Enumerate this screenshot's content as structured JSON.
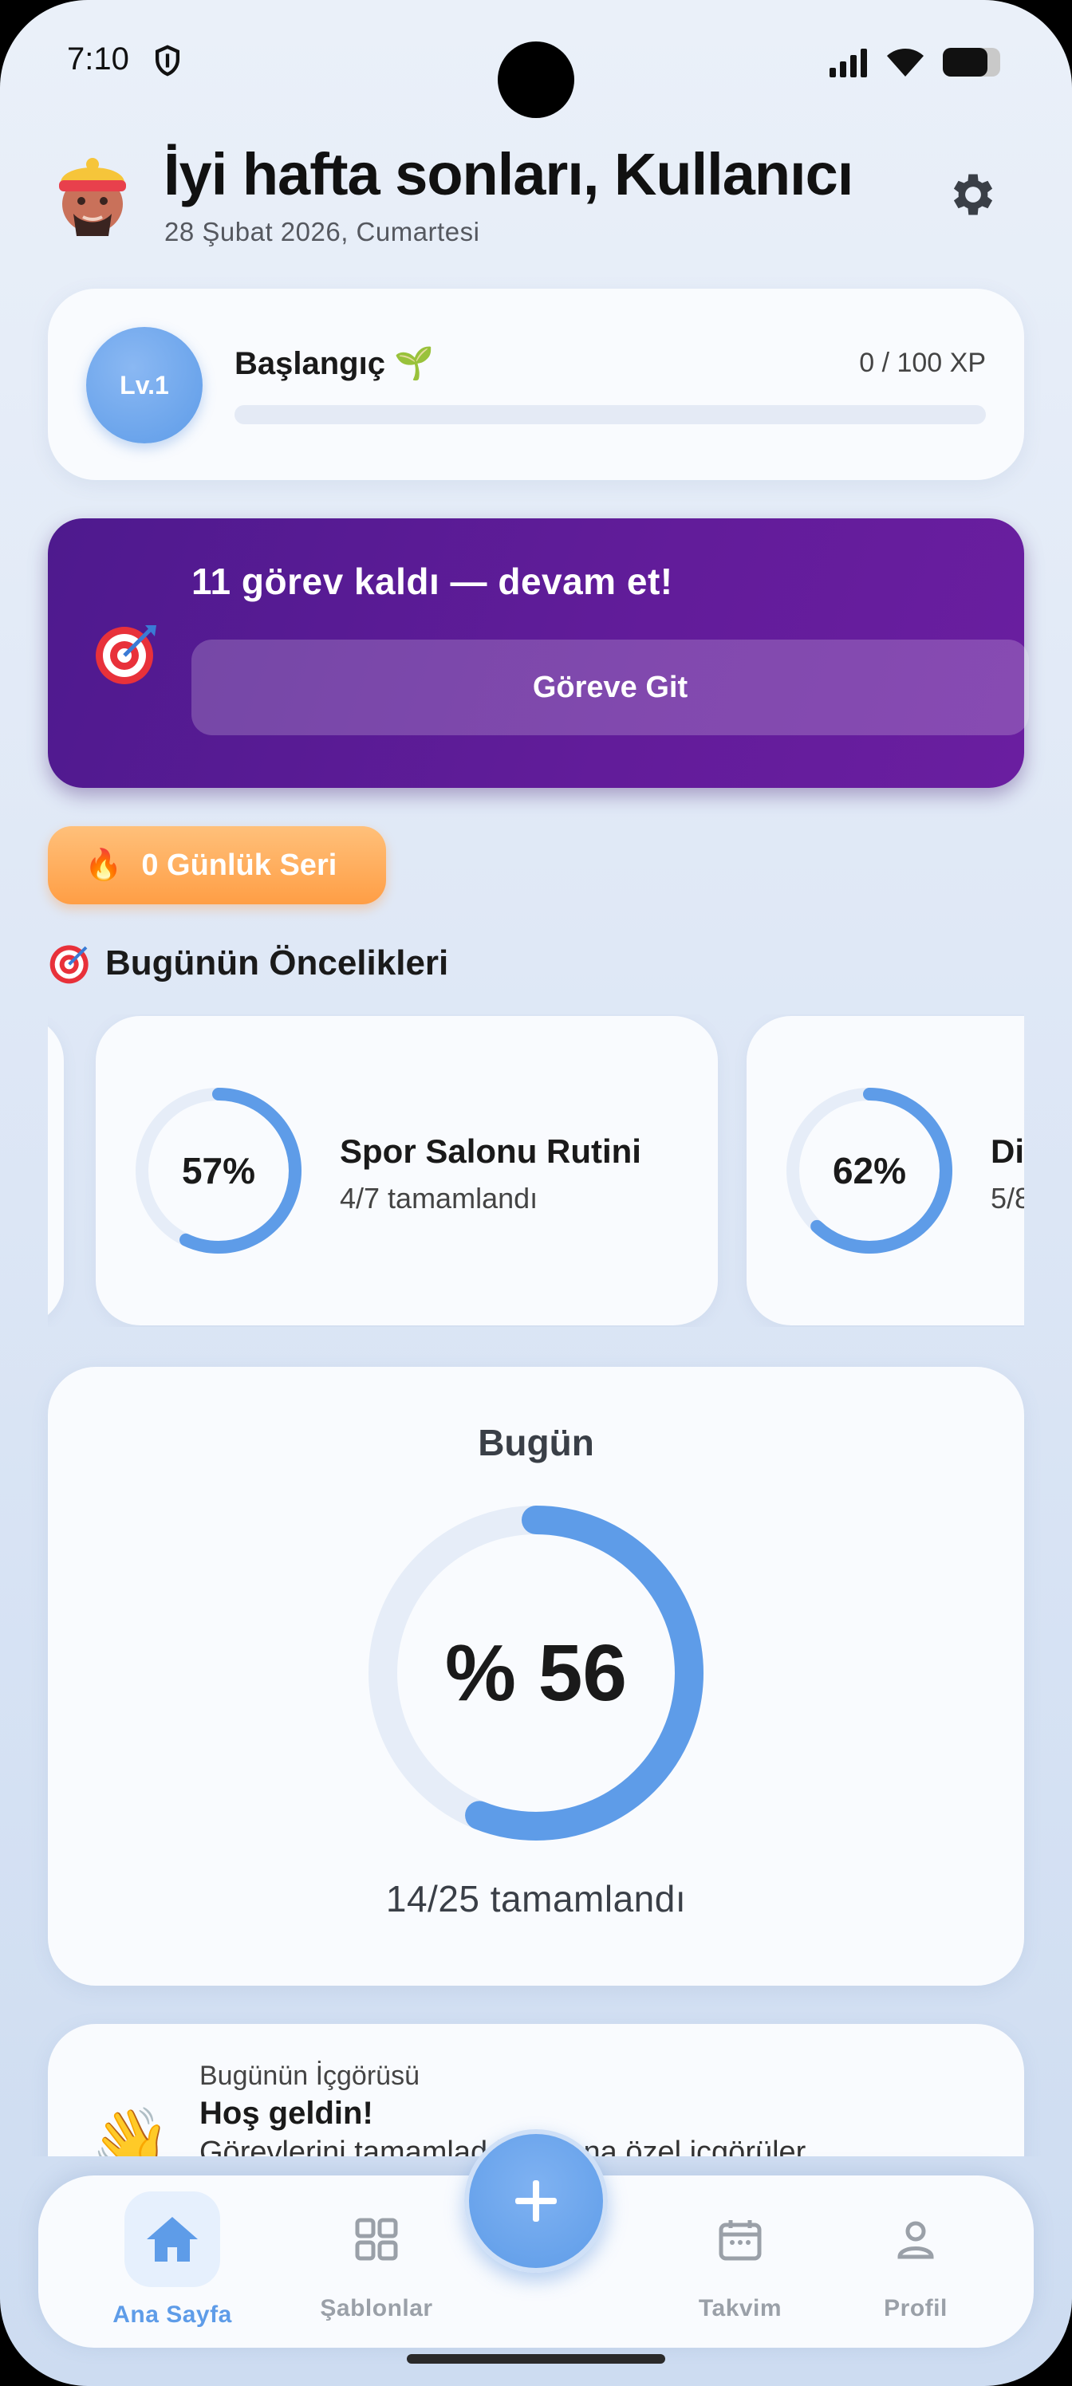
{
  "status_bar": {
    "time": "7:10"
  },
  "header": {
    "greeting": "İyi hafta sonları, Kullanıcı",
    "date": "28 Şubat 2026, Cumartesi"
  },
  "level": {
    "badge": "Lv.1",
    "title": "Başlangıç 🌱",
    "xp": "0 / 100 XP",
    "progress": 0
  },
  "task_banner": {
    "title": "11 görev kaldı — devam et!",
    "button": "Göreve Git"
  },
  "streak": {
    "label": "0 Günlük Seri"
  },
  "priorities": {
    "title": "Bugünün Öncelikleri",
    "items": [
      {
        "percent": "57%",
        "value": 0.57,
        "name": "Spor Salonu Rutini",
        "sub": "4/7 tamamlandı"
      },
      {
        "percent": "62%",
        "value": 0.62,
        "name": "Di",
        "sub": "5/8"
      }
    ]
  },
  "today": {
    "title": "Bugün",
    "percent": "% 56",
    "value": 0.56,
    "sub": "14/25 tamamlandı"
  },
  "insight": {
    "label": "Bugünün İçgörüsü",
    "title": "Hoş geldin!",
    "text": "Görevlerini tamamladıkça sana özel içgörüler",
    "emoji": "👋"
  },
  "nav": {
    "items": [
      {
        "label": "Ana Sayfa",
        "icon": "home-icon"
      },
      {
        "label": "Şablonlar",
        "icon": "grid-icon"
      },
      {
        "label": "Takvim",
        "icon": "calendar-icon"
      },
      {
        "label": "Profil",
        "icon": "person-icon"
      }
    ],
    "fab_icon": "plus-icon"
  },
  "colors": {
    "accent": "#5e9ce8",
    "banner": "#5a1b94",
    "streak": "#ffa552"
  }
}
